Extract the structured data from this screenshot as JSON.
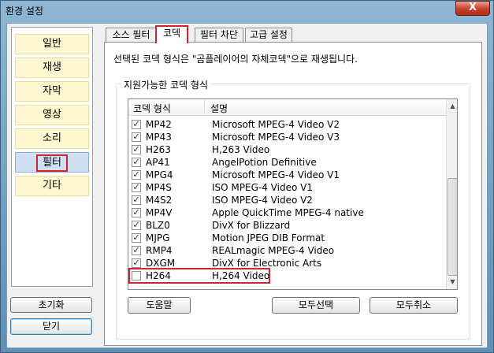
{
  "window": {
    "title": "환경 설정",
    "close_glyph": "X"
  },
  "nav": {
    "items": [
      {
        "label": "일반"
      },
      {
        "label": "재생"
      },
      {
        "label": "자막"
      },
      {
        "label": "영상"
      },
      {
        "label": "소리"
      },
      {
        "label": "필터",
        "active": true
      },
      {
        "label": "기타"
      }
    ],
    "reset_label": "초기화",
    "close_label": "닫기"
  },
  "tabs": [
    {
      "label": "소스 필터"
    },
    {
      "label": "코덱",
      "active": true
    },
    {
      "label": "필터 차단"
    },
    {
      "label": "고급 설정"
    }
  ],
  "codec_page": {
    "notice": "선택된 코덱 형식은 \"곰플레이어의 자체코덱\"으로 재생됩니다.",
    "group_label": "지원가능한 코덱 형식",
    "columns": {
      "format": "코덱 형식",
      "description": "설명"
    },
    "rows": [
      {
        "format": "MP42",
        "description": "Microsoft MPEG-4 Video V2",
        "checked": true
      },
      {
        "format": "MP43",
        "description": "Microsoft MPEG-4 Video V3",
        "checked": true
      },
      {
        "format": "H263",
        "description": "H,263 Video",
        "checked": true
      },
      {
        "format": "AP41",
        "description": "AngelPotion Definitive",
        "checked": true
      },
      {
        "format": "MPG4",
        "description": "Microsoft MPEG-4 Video V1",
        "checked": true
      },
      {
        "format": "MP4S",
        "description": "ISO MPEG-4 Video V1",
        "checked": true
      },
      {
        "format": "M4S2",
        "description": "ISO MPEG-4 Video V2",
        "checked": true
      },
      {
        "format": "MP4V",
        "description": "Apple QuickTime MPEG-4 native",
        "checked": true
      },
      {
        "format": "BLZ0",
        "description": "DivX for Blizzard",
        "checked": true
      },
      {
        "format": "MJPG",
        "description": "Motion JPEG DIB Format",
        "checked": true
      },
      {
        "format": "RMP4",
        "description": "REALmagic MPEG-4 Video",
        "checked": true
      },
      {
        "format": "DXGM",
        "description": "DivX for Electronic Arts",
        "checked": true
      },
      {
        "format": "H264",
        "description": "H,264 Video",
        "checked": false
      }
    ],
    "help_label": "도움말",
    "select_all_label": "모두선택",
    "deselect_all_label": "모두취소"
  },
  "colors": {
    "highlight": "#d0242f",
    "nav_item_bg": "#fff7cf",
    "nav_active_bg": "#cfe0f5"
  }
}
